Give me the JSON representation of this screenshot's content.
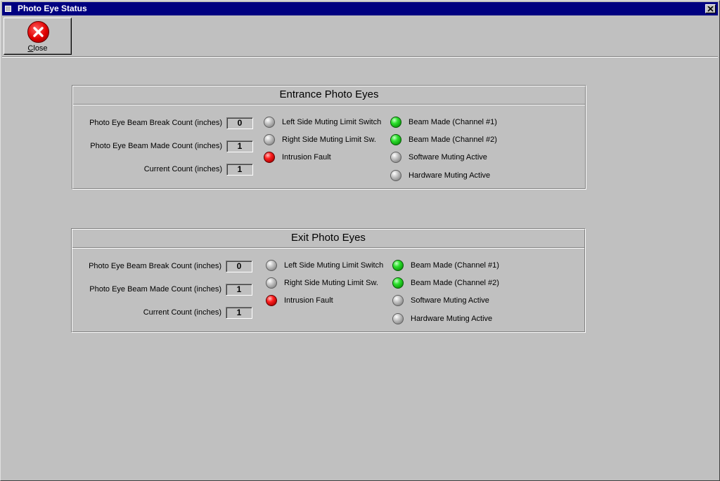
{
  "window": {
    "title": "Photo Eye Status",
    "close_icon": "close-x-icon"
  },
  "toolbar": {
    "close_label_underlined": "C",
    "close_label_rest": "lose",
    "close_icon": "red-circle-x-icon"
  },
  "entrance": {
    "title": "Entrance Photo Eyes",
    "counts": [
      {
        "label": "Photo Eye Beam Break Count (inches)",
        "value": "0"
      },
      {
        "label": "Photo Eye Beam Made Count (inches)",
        "value": "1"
      },
      {
        "label": "Current Count (inches)",
        "value": "1"
      }
    ],
    "indicators_left": [
      {
        "label": "Left Side Muting Limit Switch",
        "state": "off",
        "color": "gray"
      },
      {
        "label": "Right Side Muting Limit Sw.",
        "state": "off",
        "color": "gray"
      },
      {
        "label": "Intrusion Fault",
        "state": "on",
        "color": "red"
      }
    ],
    "indicators_right": [
      {
        "label": "Beam Made (Channel #1)",
        "state": "on",
        "color": "green"
      },
      {
        "label": "Beam Made (Channel #2)",
        "state": "on",
        "color": "green"
      },
      {
        "label": "Software Muting Active",
        "state": "off",
        "color": "gray"
      },
      {
        "label": "Hardware Muting Active",
        "state": "off",
        "color": "gray"
      }
    ]
  },
  "exit": {
    "title": "Exit Photo Eyes",
    "counts": [
      {
        "label": "Photo Eye Beam Break Count (inches)",
        "value": "0"
      },
      {
        "label": "Photo Eye Beam Made Count (inches)",
        "value": "1"
      },
      {
        "label": "Current Count (inches)",
        "value": "1"
      }
    ],
    "indicators_left": [
      {
        "label": "Left Side Muting Limit Switch",
        "state": "off",
        "color": "gray"
      },
      {
        "label": "Right Side Muting Limit Sw.",
        "state": "off",
        "color": "gray"
      },
      {
        "label": "Intrusion Fault",
        "state": "on",
        "color": "red"
      }
    ],
    "indicators_right": [
      {
        "label": "Beam Made (Channel #1)",
        "state": "on",
        "color": "green"
      },
      {
        "label": "Beam Made (Channel #2)",
        "state": "on",
        "color": "green"
      },
      {
        "label": "Software Muting Active",
        "state": "off",
        "color": "gray"
      },
      {
        "label": "Hardware Muting Active",
        "state": "off",
        "color": "gray"
      }
    ]
  },
  "colors": {
    "titlebar": "#000080",
    "background": "#c0c0c0",
    "led_green": "#2ee02e",
    "led_red": "#ff2020",
    "led_gray": "#a0a0a0"
  }
}
